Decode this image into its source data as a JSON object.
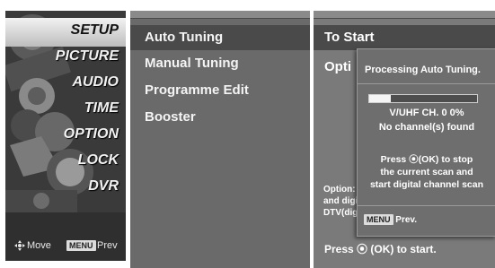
{
  "categories": [
    {
      "label": "SETUP",
      "icon": "setup-icon",
      "selected": true
    },
    {
      "label": "PICTURE",
      "icon": "picture-icon"
    },
    {
      "label": "AUDIO",
      "icon": "audio-icon"
    },
    {
      "label": "TIME",
      "icon": "time-icon"
    },
    {
      "label": "OPTION",
      "icon": "option-icon"
    },
    {
      "label": "LOCK",
      "icon": "lock-icon"
    },
    {
      "label": "DVR",
      "icon": "dvr-icon"
    }
  ],
  "footer": {
    "move": "Move",
    "prev_key": "MENU",
    "prev": "Prev"
  },
  "submenu": {
    "items": [
      {
        "label": "Auto Tuning",
        "selected": true
      },
      {
        "label": "Manual Tuning"
      },
      {
        "label": "Programme Edit"
      },
      {
        "label": "Booster"
      }
    ]
  },
  "detail": {
    "heading": "To Start",
    "option": "Opti",
    "option_text": [
      "Option:",
      "and digi",
      "DTV(dig"
    ],
    "press": "Press ⦿ (OK) to start."
  },
  "popup": {
    "title": "Processing Auto Tuning.",
    "progress": 0.2,
    "channel": "V/UHF CH. 0 0%",
    "found": "No channel(s) found",
    "instructions": [
      "Press ⦿(OK) to stop",
      "the current scan and",
      "start digital channel scan"
    ],
    "menu_key": "MENU",
    "prev": "Prev."
  },
  "colors": {
    "selected_bar": "#dddddd",
    "panel": "#6a6a6a",
    "panel_dark": "#4a4a4a"
  }
}
